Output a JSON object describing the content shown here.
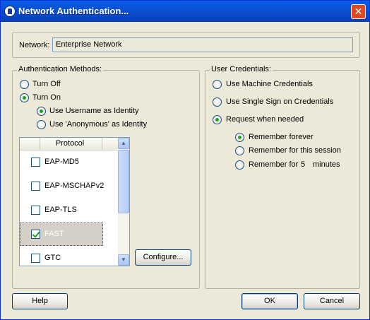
{
  "window": {
    "title": "Network Authentication..."
  },
  "network": {
    "label": "Network:",
    "value": "Enterprise Network"
  },
  "auth_methods": {
    "legend": "Authentication Methods:",
    "turn_off": "Turn Off",
    "turn_on": "Turn On",
    "selected": "turn_on",
    "use_username": "Use Username as Identity",
    "use_anonymous": "Use 'Anonymous' as Identity",
    "identity_selected": "use_username",
    "protocol_header": "Protocol",
    "protocols": [
      {
        "name": "EAP-MD5",
        "checked": false
      },
      {
        "name": "EAP-MSCHAPv2",
        "checked": false
      },
      {
        "name": "EAP-TLS",
        "checked": false
      },
      {
        "name": "FAST",
        "checked": true,
        "selected": true
      },
      {
        "name": "GTC",
        "checked": false
      }
    ],
    "configure_label": "Configure..."
  },
  "user_credentials": {
    "legend": "User Credentials:",
    "machine": "Use Machine Credentials",
    "sso": "Use Single Sign on Credentials",
    "request": "Request when needed",
    "selected": "request",
    "remember_forever": "Remember forever",
    "remember_session": "Remember for this session",
    "remember_for": "Remember for",
    "remember_minutes_value": "5",
    "remember_minutes_unit": "minutes",
    "remember_selected": "forever"
  },
  "buttons": {
    "help": "Help",
    "ok": "OK",
    "cancel": "Cancel"
  }
}
